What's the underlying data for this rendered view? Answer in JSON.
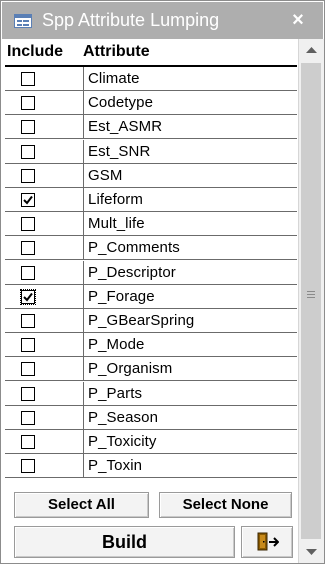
{
  "window": {
    "title": "Spp Attribute Lumping",
    "close_glyph": "×",
    "icon": "form-icon"
  },
  "table": {
    "columns": [
      "Include",
      "Attribute"
    ],
    "rows": [
      {
        "include": false,
        "attribute": "Climate"
      },
      {
        "include": false,
        "attribute": "Codetype"
      },
      {
        "include": false,
        "attribute": "Est_ASMR"
      },
      {
        "include": false,
        "attribute": "Est_SNR"
      },
      {
        "include": false,
        "attribute": "GSM"
      },
      {
        "include": true,
        "attribute": "Lifeform"
      },
      {
        "include": false,
        "attribute": "Mult_life"
      },
      {
        "include": false,
        "attribute": "P_Comments"
      },
      {
        "include": false,
        "attribute": "P_Descriptor"
      },
      {
        "include": true,
        "attribute": "P_Forage",
        "focused": true
      },
      {
        "include": false,
        "attribute": "P_GBearSpring"
      },
      {
        "include": false,
        "attribute": "P_Mode"
      },
      {
        "include": false,
        "attribute": "P_Organism"
      },
      {
        "include": false,
        "attribute": "P_Parts"
      },
      {
        "include": false,
        "attribute": "P_Season"
      },
      {
        "include": false,
        "attribute": "P_Toxicity"
      },
      {
        "include": false,
        "attribute": "P_Toxin"
      }
    ]
  },
  "buttons": {
    "select_all": "Select All",
    "select_none": "Select None",
    "build": "Build",
    "exit_icon": "exit-door-icon"
  },
  "colors": {
    "titlebar": "#aeaeae",
    "title_text": "#ffffff",
    "button_bg": "#f3f3f3"
  }
}
